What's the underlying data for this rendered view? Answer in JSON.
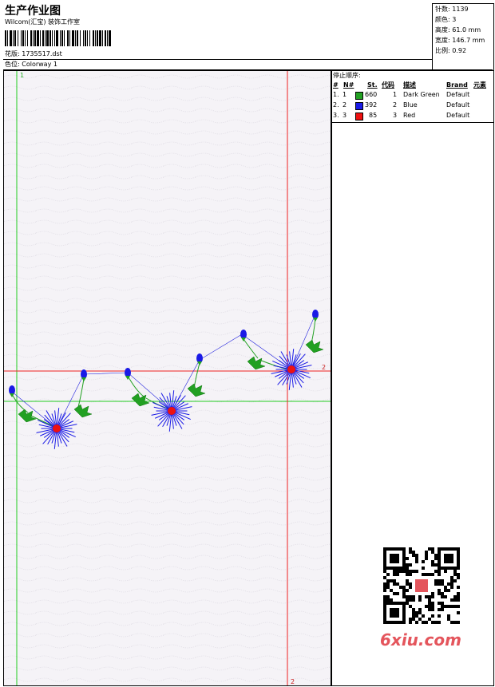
{
  "header": {
    "title": "生产作业图",
    "subtitle": "Wilcom(汇宝) 装饰工作室",
    "design_label": "花版:",
    "design_value": "1735517.dst",
    "colorway_label": "色位:",
    "colorway_value": "Colorway 1"
  },
  "stats": [
    {
      "label": "针数:",
      "value": "1139"
    },
    {
      "label": "颜色:",
      "value": "3"
    },
    {
      "label": "高度:",
      "value": "61.0 mm"
    },
    {
      "label": "宽度:",
      "value": "146.7 mm"
    },
    {
      "label": "比例:",
      "value": "0.92"
    }
  ],
  "stop_sequence": {
    "title": "停止顺序:",
    "columns": [
      "#",
      "N#",
      "St.",
      "代码",
      "描述",
      "Brand",
      "元素"
    ],
    "rows": [
      {
        "num": "1.",
        "n": "1",
        "color": "#22a022",
        "stitches": "660",
        "code": "1",
        "desc": "Dark Green",
        "brand": "Default"
      },
      {
        "num": "2.",
        "n": "2",
        "color": "#1a1ae6",
        "stitches": "392",
        "code": "2",
        "desc": "Blue",
        "brand": "Default"
      },
      {
        "num": "3.",
        "n": "3",
        "color": "#ee1111",
        "stitches": "85",
        "code": "3",
        "desc": "Red",
        "brand": "Default"
      }
    ]
  },
  "guides": {
    "green_label": "1",
    "red_label_top": "2",
    "red_label_bottom": "2"
  },
  "logo": "6xiu.com",
  "colors": {
    "green": "#22a022",
    "blue": "#1a1ae6",
    "red": "#ee1111"
  }
}
